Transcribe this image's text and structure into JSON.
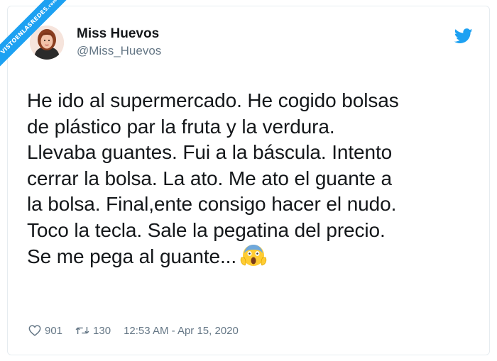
{
  "watermark": {
    "main": "VISTOENLASREDES",
    "suffix": ".com"
  },
  "user": {
    "display_name": "Miss Huevos",
    "handle": "@Miss_Huevos",
    "avatar_icon": "avatar-woman-illustration"
  },
  "brand": {
    "icon": "twitter-bird-icon",
    "color": "#1da1f2"
  },
  "tweet": {
    "text": "He ido al supermercado. He cogido bolsas\nde plástico par la fruta y la verdura.\nLlevaba guantes. Fui a la báscula. Intento\ncerrar la bolsa. La ato. Me ato el guante a\nla bolsa. Final,ente consigo hacer el nudo.\nToco la tecla. Sale la pegatina del precio.\nSe me pega al guante...",
    "emoji": "screaming-face-emoji"
  },
  "footer": {
    "likes": "901",
    "retweets": "130",
    "timestamp": "12:53 AM - Apr 15, 2020"
  },
  "colors": {
    "text": "#14171a",
    "secondary": "#657786",
    "border": "#e6ecf0"
  }
}
